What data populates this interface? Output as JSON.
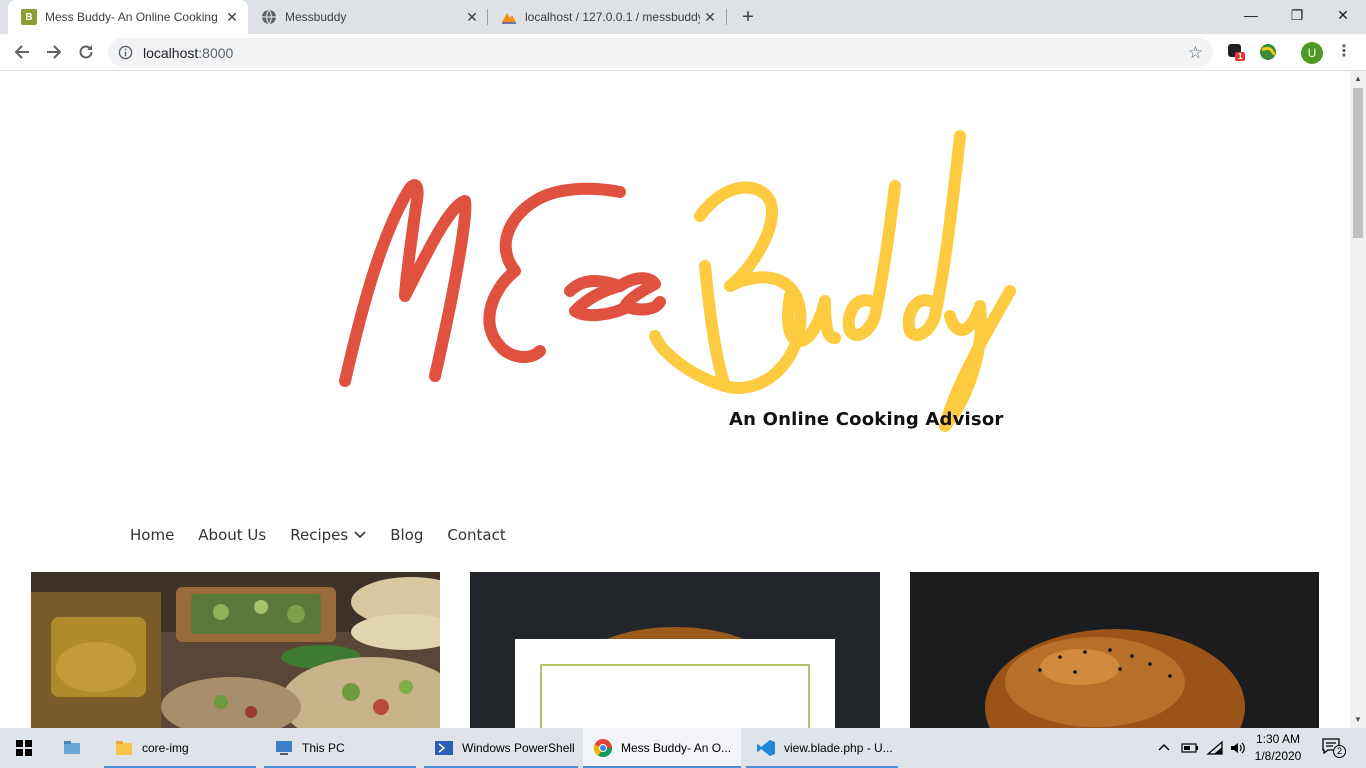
{
  "browser": {
    "tabs": [
      {
        "title": "Mess Buddy- An Online Cooking",
        "favicon": "bootstrap-b-icon",
        "active": true
      },
      {
        "title": "Messbuddy",
        "favicon": "globe-icon",
        "active": false
      },
      {
        "title": "localhost / 127.0.0.1 / messbuddy",
        "favicon": "phpmyadmin-icon",
        "active": false
      }
    ],
    "new_tab": "+",
    "window_controls": {
      "minimize": "—",
      "restore": "❐",
      "close": "✕"
    },
    "url": {
      "host": "localhost",
      "port": ":8000"
    },
    "profile_initial": "U",
    "extension_badge": "1"
  },
  "site": {
    "logo_left": "MEss",
    "logo_right": "Buddy",
    "tagline": "An Online Cooking Advisor",
    "nav": [
      {
        "label": "Home"
      },
      {
        "label": "About Us"
      },
      {
        "label": "Recipes",
        "has_dropdown": true
      },
      {
        "label": "Blog"
      },
      {
        "label": "Contact"
      }
    ],
    "colors": {
      "logo_red": "#e0513f",
      "logo_yellow": "#fccb3f",
      "accent_green": "#b5c26b"
    }
  },
  "taskbar": {
    "items": [
      {
        "label": "",
        "icon": "file-explorer-icon"
      },
      {
        "label": "core-img",
        "icon": "folder-icon"
      },
      {
        "label": "This PC",
        "icon": "this-pc-icon"
      },
      {
        "label": "Windows PowerShell",
        "icon": "powershell-icon"
      },
      {
        "label": "Mess Buddy- An O...",
        "icon": "chrome-icon"
      },
      {
        "label": "view.blade.php - U...",
        "icon": "vscode-icon"
      }
    ],
    "time": "1:30 AM",
    "date": "1/8/2020",
    "notification_count": "2"
  }
}
